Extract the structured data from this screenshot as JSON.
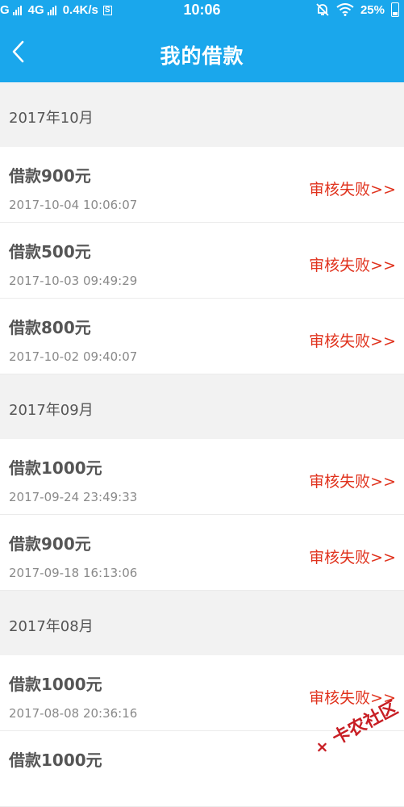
{
  "status_bar": {
    "sim1": "G",
    "sim2": "4G",
    "speed": "0.4K/s",
    "sim_icon_text": "S",
    "time": "10:06",
    "battery": "25%"
  },
  "header": {
    "title": "我的借款"
  },
  "groups": [
    {
      "month": "2017年10月",
      "items": [
        {
          "title": "借款900元",
          "date": "2017-10-04 10:06:07",
          "status": "审核失败>>"
        },
        {
          "title": "借款500元",
          "date": "2017-10-03 09:49:29",
          "status": "审核失败>>"
        },
        {
          "title": "借款800元",
          "date": "2017-10-02 09:40:07",
          "status": "审核失败>>"
        }
      ]
    },
    {
      "month": "2017年09月",
      "items": [
        {
          "title": "借款1000元",
          "date": "2017-09-24 23:49:33",
          "status": "审核失败>>"
        },
        {
          "title": "借款900元",
          "date": "2017-09-18 16:13:06",
          "status": "审核失败>>"
        }
      ]
    },
    {
      "month": "2017年08月",
      "items": [
        {
          "title": "借款1000元",
          "date": "2017-08-08 20:36:16",
          "status": "审核失败>>"
        },
        {
          "title": "借款1000元",
          "date": "",
          "status": ""
        }
      ]
    }
  ],
  "watermark": {
    "text": "卡农社区"
  },
  "colors": {
    "primary": "#1aa7ec",
    "status_fail": "#e0321d"
  }
}
